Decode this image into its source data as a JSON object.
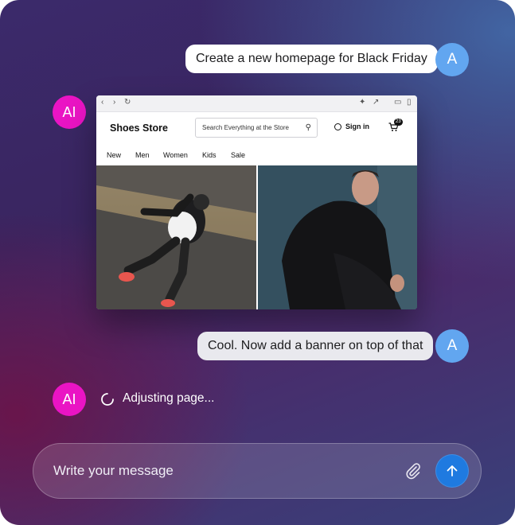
{
  "messages": [
    {
      "role": "user",
      "avatar": "A",
      "text": "Create a new homepage for Black Friday"
    },
    {
      "role": "ai",
      "avatar": "AI"
    },
    {
      "role": "user",
      "avatar": "A",
      "text": "Cool. Now add a banner on top of that"
    },
    {
      "role": "ai",
      "avatar": "AI",
      "status": "Adjusting page..."
    }
  ],
  "preview": {
    "store_name": "Shoes Store",
    "search_placeholder": "Search Everything at the Store",
    "sign_in": "Sign in",
    "cart_count": "23",
    "nav": [
      "New",
      "Men",
      "Women",
      "Kids",
      "Sale"
    ]
  },
  "composer": {
    "placeholder": "Write your message"
  },
  "icons": {
    "spinner": "loading-spinner-icon",
    "attach": "paperclip-icon",
    "send": "arrow-up-icon"
  },
  "colors": {
    "user_avatar": "#62a6f0",
    "ai_avatar": "#ea14c4",
    "send_button": "#1f7ae0"
  }
}
